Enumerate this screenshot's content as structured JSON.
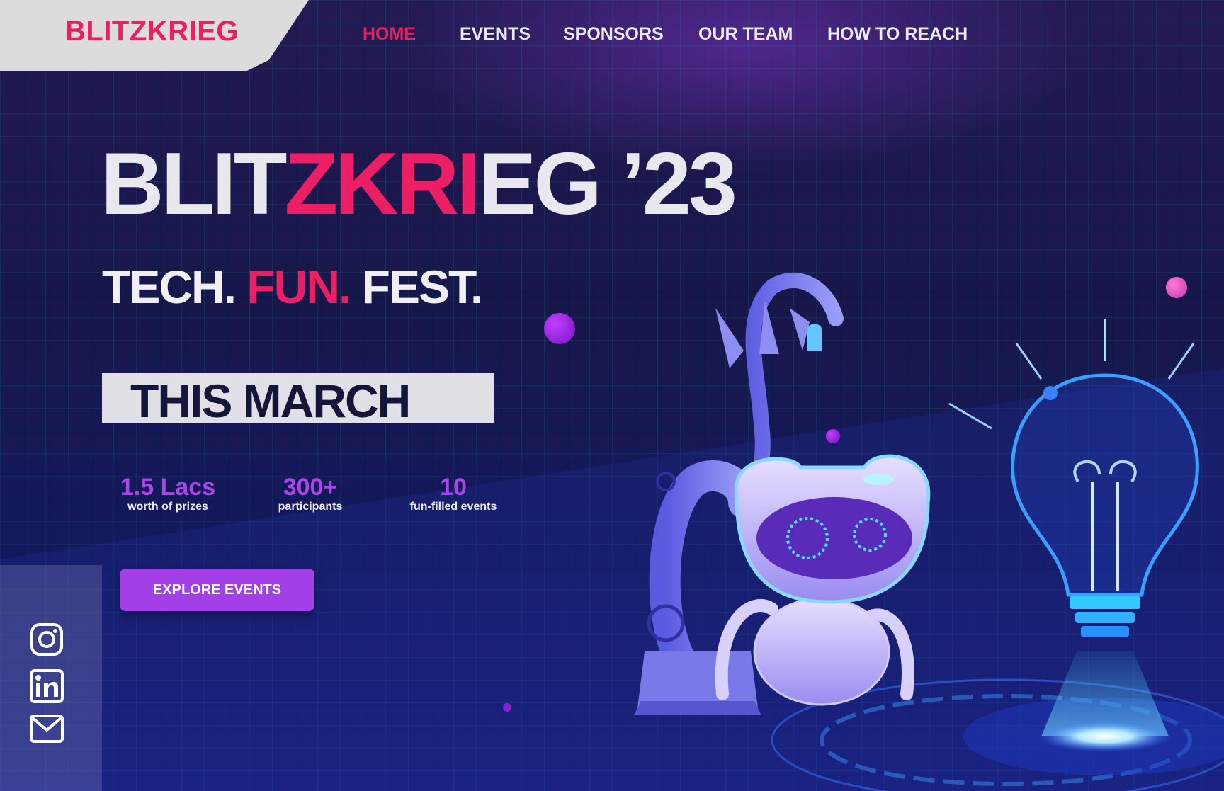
{
  "brand": {
    "name": "BLITZKRIEG"
  },
  "nav": {
    "items": [
      {
        "label": "HOME",
        "active": true
      },
      {
        "label": "EVENTS",
        "active": false
      },
      {
        "label": "SPONSORS",
        "active": false
      },
      {
        "label": "OUR TEAM",
        "active": false
      },
      {
        "label": "HOW TO REACH",
        "active": false
      }
    ]
  },
  "hero": {
    "title_part1": "BLIT",
    "title_part2": "ZKRI",
    "title_part3": "EG ’23",
    "tagline_1": "TECH.",
    "tagline_2": "FUN.",
    "tagline_3": "FEST.",
    "highlight": "THIS MARCH"
  },
  "stats": [
    {
      "value": "1.5 Lacs",
      "label": "worth of prizes"
    },
    {
      "value": "300+",
      "label": "participants"
    },
    {
      "value": "10",
      "label": "fun-filled events"
    }
  ],
  "cta": {
    "label": "EXPLORE EVENTS"
  },
  "social": [
    {
      "icon": "instagram-icon"
    },
    {
      "icon": "linkedin-icon"
    },
    {
      "icon": "mail-icon"
    }
  ],
  "colors": {
    "accent": "#ec1e64",
    "purple": "#a33fe6",
    "background": "#17174a"
  }
}
